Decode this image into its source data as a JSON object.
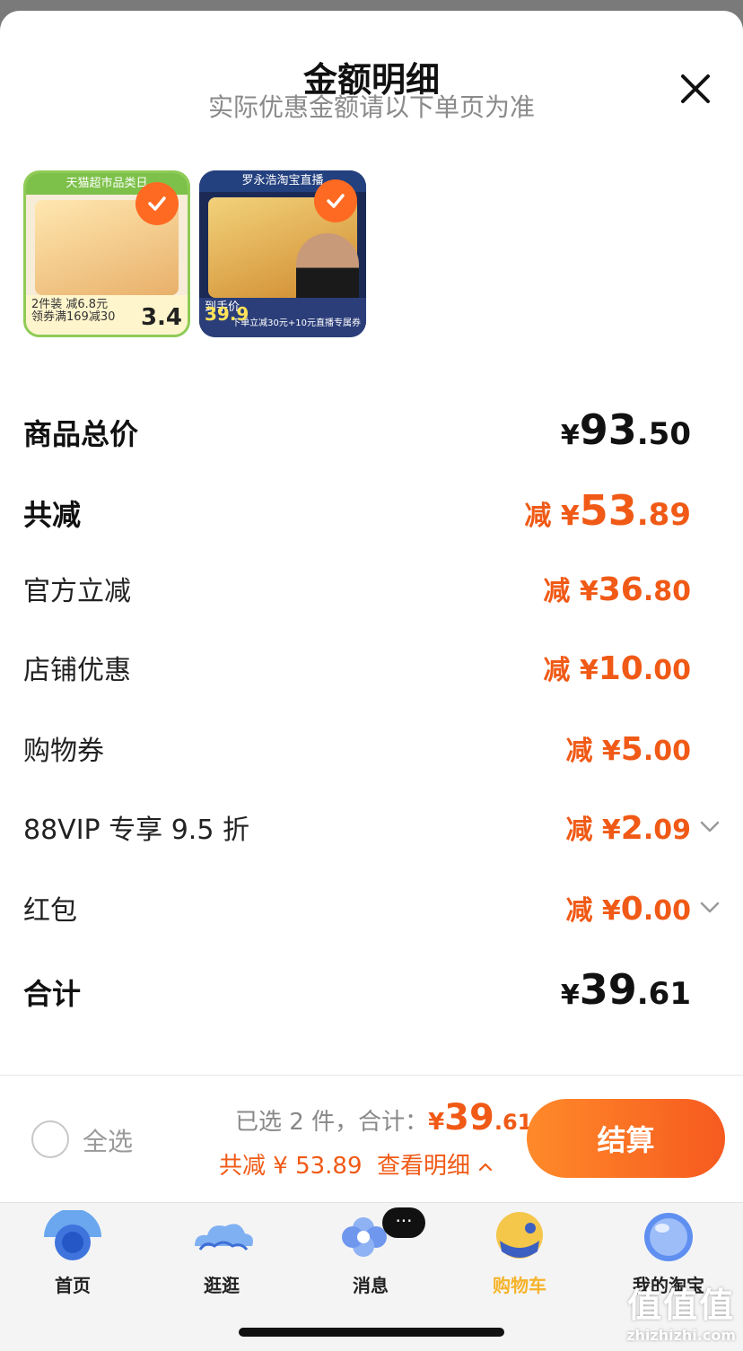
{
  "sheet": {
    "title": "金额明细",
    "subtitle": "实际优惠金额请以下单页为准"
  },
  "products": [
    {
      "banner": "天猫超市品类日",
      "foot_line1": "2件装 减6.8元",
      "foot_line2": "领券满169减30",
      "price": "3.4"
    },
    {
      "banner": "罗永浩淘宝直播",
      "foot_line1": "到手价",
      "foot_line2": "下单立减30元+10元直播专属券",
      "price": "39.9"
    }
  ],
  "breakdown": {
    "total": {
      "label": "商品总价",
      "prefix": "¥",
      "int": "93",
      "dec": ".50"
    },
    "discount": {
      "label": "共减",
      "prefix": "减 ¥",
      "int": "53",
      "dec": ".89"
    },
    "official": {
      "label": "官方立减",
      "prefix": "减 ¥",
      "int": "36",
      "dec": ".80"
    },
    "store": {
      "label": "店铺优惠",
      "prefix": "减 ¥",
      "int": "10",
      "dec": ".00"
    },
    "coupon": {
      "label": "购物券",
      "prefix": "减 ¥",
      "int": "5",
      "dec": ".00"
    },
    "vip": {
      "label": "88VIP 专享 9.5 折",
      "prefix": "减 ¥",
      "int": "2",
      "dec": ".09"
    },
    "redpacket": {
      "label": "红包",
      "prefix": "减 ¥",
      "int": "0",
      "dec": ".00"
    },
    "sum": {
      "label": "合计",
      "prefix": "¥",
      "int": "39",
      "dec": ".61"
    }
  },
  "checkout": {
    "select_all": "全选",
    "selected_text": "已选 2 件，合计：",
    "amount_prefix": "¥",
    "amount_int": "39",
    "amount_dec": ".61",
    "saved_text": "共减 ¥ 53.89",
    "detail_link": "查看明细",
    "pay_label": "结算"
  },
  "tabbar": {
    "badge": "···",
    "items": [
      {
        "label": "首页"
      },
      {
        "label": "逛逛"
      },
      {
        "label": "消息"
      },
      {
        "label": "购物车",
        "active": true
      },
      {
        "label": "我的淘宝"
      }
    ]
  },
  "watermark": {
    "title": "值值值",
    "domain": "zhizhizhi.com"
  },
  "colors": {
    "accent": "#f05a16",
    "active_tab": "#f5b32a"
  }
}
